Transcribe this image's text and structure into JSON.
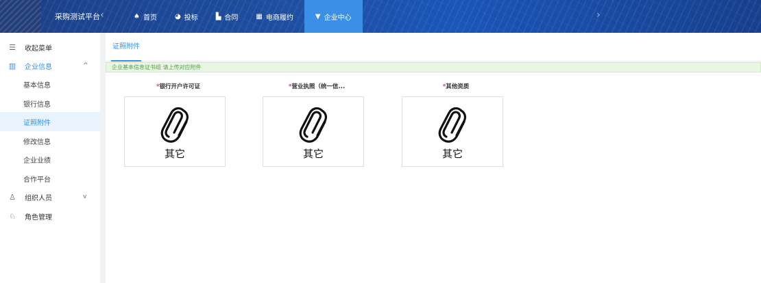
{
  "header": {
    "brand": "采购测试平台",
    "nav": [
      {
        "label": "首页",
        "icon": "home-icon",
        "glyph": "♠"
      },
      {
        "label": "投标",
        "icon": "bid-icon",
        "glyph": "◕"
      },
      {
        "label": "合同",
        "icon": "contract-icon",
        "glyph": "▙"
      },
      {
        "label": "电商履约",
        "icon": "ecommerce-icon",
        "glyph": "▦"
      },
      {
        "label": "企业中心",
        "icon": "enterprise-icon",
        "glyph": "▼"
      }
    ],
    "active_nav": "企业中心",
    "colors": {
      "bar": "#1d4fa3",
      "active": "#3b8fe6"
    }
  },
  "sidebar": {
    "collapse_label": "收起菜单",
    "groups": [
      {
        "label": "企业信息",
        "icon": "building-icon",
        "caret": "^",
        "expanded": true,
        "items": [
          "基本信息",
          "银行信息",
          "证照附件",
          "修改信息",
          "企业业绩",
          "合作平台"
        ]
      },
      {
        "label": "组织人员",
        "icon": "org-icon",
        "caret": "v",
        "expanded": false
      },
      {
        "label": "角色管理",
        "icon": "role-icon"
      }
    ],
    "active_item": "证照附件"
  },
  "main": {
    "tab": "证照附件",
    "notice": "企业基本信息证书组 请上传对应附件",
    "cards": [
      {
        "label": "银行开户许可证",
        "caption": "其它"
      },
      {
        "label": "营业执照（统一信...",
        "caption": "其它"
      },
      {
        "label": "其他资质",
        "caption": "其它"
      }
    ],
    "required_mark": "*",
    "accent": "#3a8ee6"
  }
}
